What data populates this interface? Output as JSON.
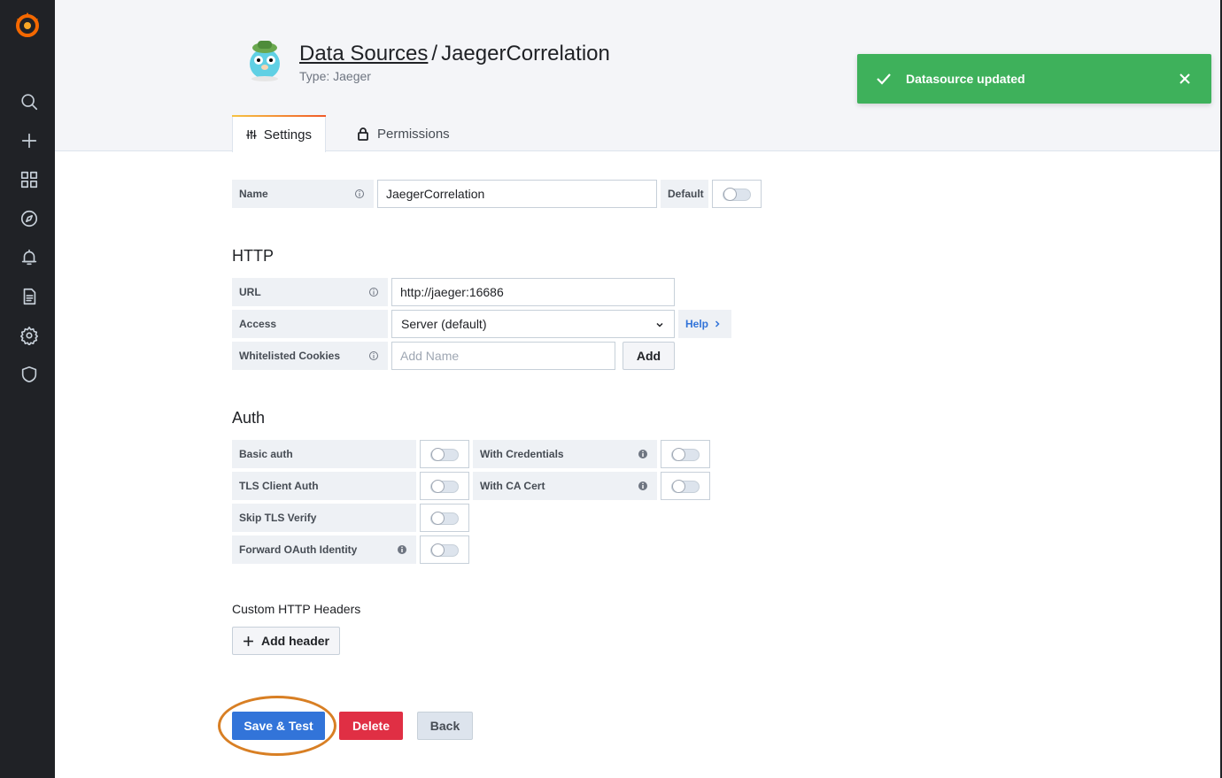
{
  "sidebar": {
    "logo": "grafana-logo",
    "items": [
      {
        "icon": "search-icon"
      },
      {
        "icon": "plus-icon"
      },
      {
        "icon": "dashboards-icon"
      },
      {
        "icon": "explore-icon"
      },
      {
        "icon": "alert-bell-icon"
      },
      {
        "icon": "document-icon"
      },
      {
        "icon": "gear-icon"
      },
      {
        "icon": "shield-icon"
      }
    ]
  },
  "header": {
    "breadcrumb": "Data Sources",
    "separator": "/",
    "title": "JaegerCorrelation",
    "subtitle": "Type: Jaeger",
    "tabs": [
      {
        "label": "Settings",
        "icon": "sliders-icon",
        "active": true
      },
      {
        "label": "Permissions",
        "icon": "lock-icon",
        "active": false
      }
    ]
  },
  "toast": {
    "message": "Datasource updated",
    "color": "#3eb15b"
  },
  "form": {
    "name_label": "Name",
    "name_value": "JaegerCorrelation",
    "default_label": "Default",
    "default_on": false,
    "http_heading": "HTTP",
    "url_label": "URL",
    "url_value": "http://jaeger:16686",
    "access_label": "Access",
    "access_value": "Server (default)",
    "help_label": "Help",
    "cookies_label": "Whitelisted Cookies",
    "cookies_placeholder": "Add Name",
    "add_label": "Add",
    "auth_heading": "Auth",
    "auth": [
      {
        "label": "Basic auth",
        "on": false
      },
      {
        "label": "TLS Client Auth",
        "on": false
      },
      {
        "label": "Skip TLS Verify",
        "on": false
      },
      {
        "label": "Forward OAuth Identity",
        "on": false
      }
    ],
    "auth_right": [
      {
        "label": "With Credentials",
        "on": false
      },
      {
        "label": "With CA Cert",
        "on": false
      }
    ],
    "custom_headers_heading": "Custom HTTP Headers",
    "add_header_label": "Add header"
  },
  "actions": {
    "save_label": "Save & Test",
    "delete_label": "Delete",
    "back_label": "Back",
    "save_color": "#3274d9",
    "delete_color": "#e02f44",
    "highlight_color": "#d87f24"
  }
}
